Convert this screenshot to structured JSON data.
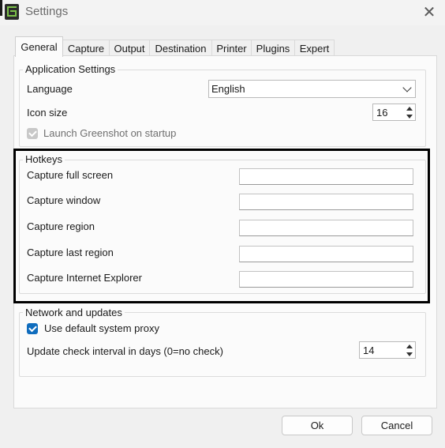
{
  "window": {
    "title": "Settings",
    "close_symbol": "✕"
  },
  "tabs": [
    {
      "label": "General",
      "active": true
    },
    {
      "label": "Capture",
      "active": false
    },
    {
      "label": "Output",
      "active": false
    },
    {
      "label": "Destination",
      "active": false
    },
    {
      "label": "Printer",
      "active": false
    },
    {
      "label": "Plugins",
      "active": false
    },
    {
      "label": "Expert",
      "active": false
    }
  ],
  "application_settings": {
    "group_label": "Application Settings",
    "language_label": "Language",
    "language_value": "English",
    "icon_size_label": "Icon size",
    "icon_size_value": "16",
    "startup_label": "Launch Greenshot on startup",
    "startup_checked": true,
    "startup_disabled": true
  },
  "hotkeys": {
    "group_label": "Hotkeys",
    "items": [
      {
        "label": "Capture full screen",
        "value": ""
      },
      {
        "label": "Capture window",
        "value": ""
      },
      {
        "label": "Capture region",
        "value": ""
      },
      {
        "label": "Capture last region",
        "value": ""
      },
      {
        "label": "Capture Internet Explorer",
        "value": ""
      }
    ]
  },
  "network": {
    "group_label": "Network and updates",
    "proxy_label": "Use default system proxy",
    "proxy_checked": true,
    "interval_label": "Update check interval in days (0=no check)",
    "interval_value": "14"
  },
  "footer": {
    "ok_label": "Ok",
    "cancel_label": "Cancel"
  },
  "colors": {
    "accent": "#0f6cbd",
    "highlight_border": "#000000",
    "window_bg": "#f0f0f0",
    "panel_bg": "#fbfbfb"
  }
}
